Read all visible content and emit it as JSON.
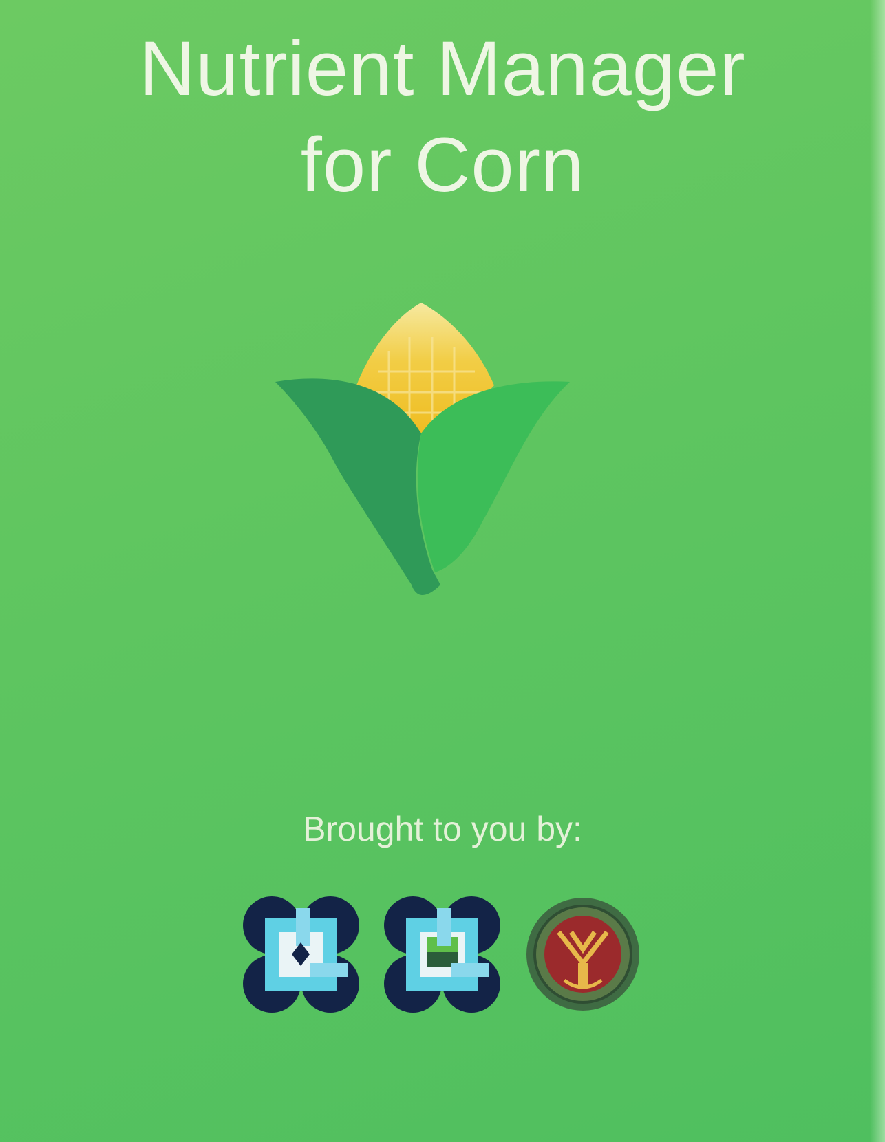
{
  "app": {
    "title_line1": "Nutrient Manager",
    "title_line2": "for Corn"
  },
  "logo": {
    "icon": "corn-icon",
    "colors": {
      "cob_light": "#f3e07a",
      "cob": "#f1c12b",
      "leaf_dark": "#2f9a58",
      "leaf_light": "#3cbd58"
    }
  },
  "credits": {
    "label": "Brought to you by:",
    "partners": [
      {
        "icon": "agency-logo-1"
      },
      {
        "icon": "agency-logo-2"
      },
      {
        "icon": "university-seal"
      }
    ]
  },
  "colors": {
    "background_top": "#6cca62",
    "background_bottom": "#4fbf5f",
    "title_text": "#eef6e4"
  }
}
